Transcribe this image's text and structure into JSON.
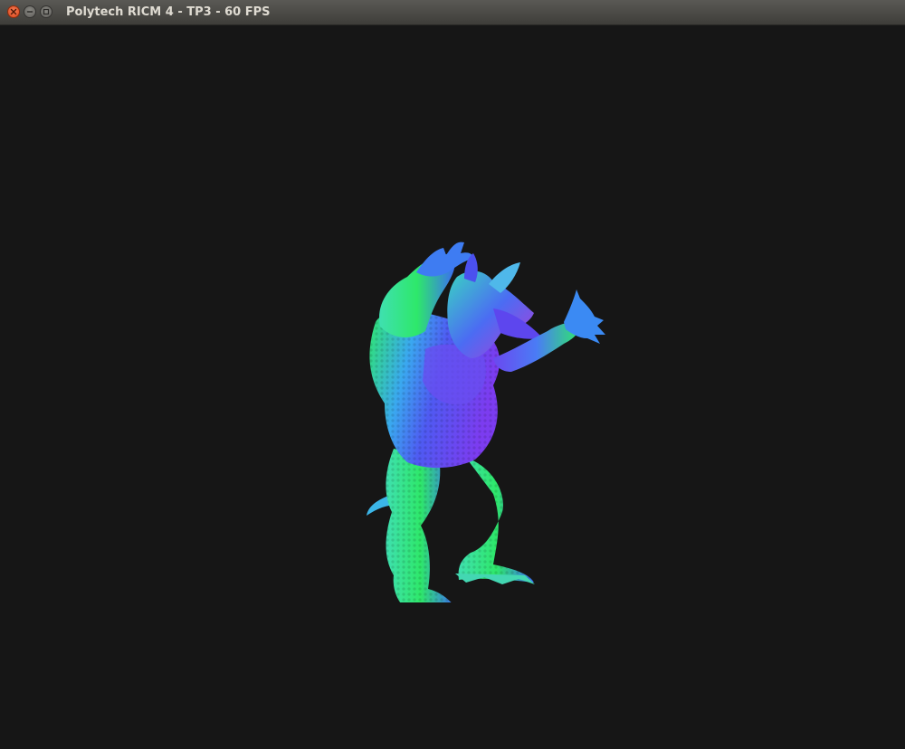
{
  "window": {
    "title": "Polytech RICM 4 - TP3 - 60 FPS",
    "controls": [
      "close-icon",
      "minimize-icon",
      "maximize-icon"
    ]
  },
  "viewport": {
    "background_color": "#161616",
    "render": "normal-shaded 3D armadillo model",
    "palette": [
      "#2ee86a",
      "#3b6cf5",
      "#7c3cf0",
      "#b43bd6",
      "#39d6c0"
    ]
  }
}
